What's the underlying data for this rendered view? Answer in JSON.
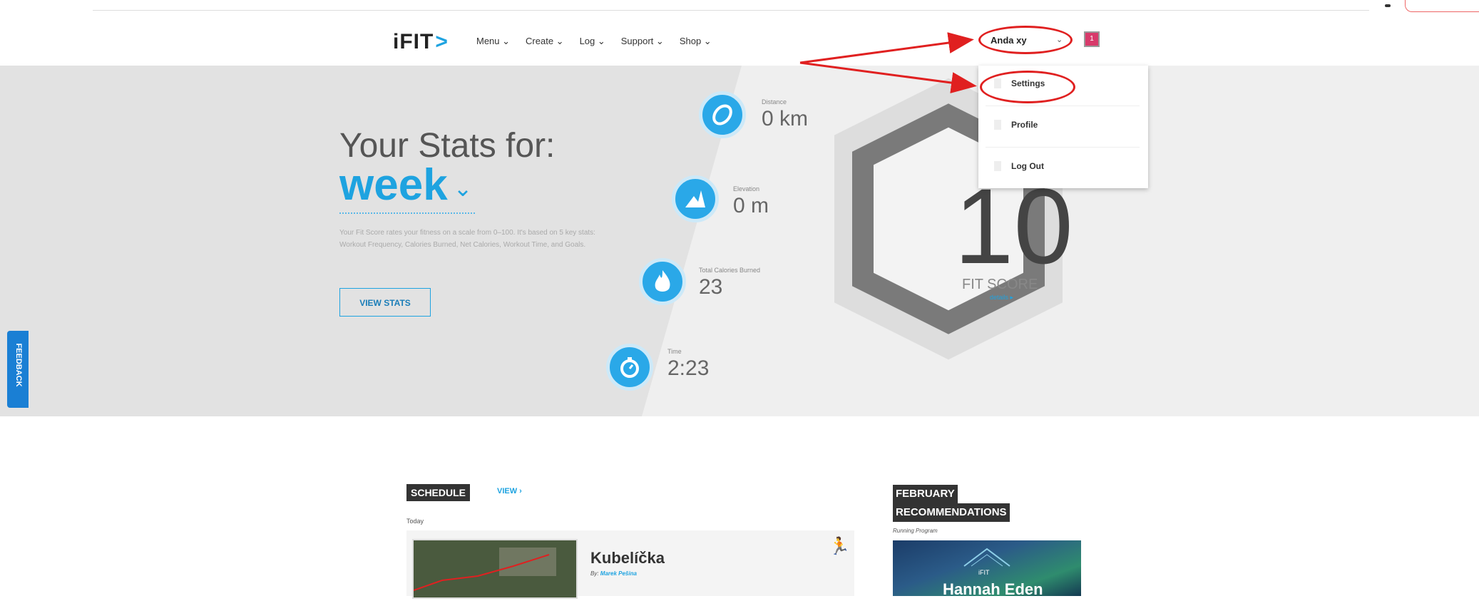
{
  "header": {
    "logo": "iFIT",
    "logo_chevron": ">",
    "nav": [
      "Menu ⌄",
      "Create ⌄",
      "Log ⌄",
      "Support ⌄",
      "Shop ⌄"
    ],
    "user_name": "Anda xy",
    "user_caret": "⌄",
    "notification_count": "1"
  },
  "dropdown": {
    "items": [
      "Settings",
      "Profile",
      "Log Out"
    ]
  },
  "hero": {
    "title": "Your Stats for:",
    "period": "week",
    "period_caret": "⌄",
    "description": "Your Fit Score rates your fitness on a scale from 0–100. It's based on 5 key stats: Workout Frequency, Calories Burned, Net Calories, Workout Time, and Goals.",
    "button": "VIEW STATS",
    "stats": [
      {
        "label": "Distance",
        "value": "0 km",
        "icon": "shoe-icon"
      },
      {
        "label": "Elevation",
        "value": "0 m",
        "icon": "mountain-icon"
      },
      {
        "label": "Total Calories Burned",
        "value": "23",
        "icon": "flame-icon"
      },
      {
        "label": "Time",
        "value": "2:23",
        "icon": "stopwatch-icon"
      }
    ],
    "fit_score": "10",
    "fit_score_label": "FIT SCORE",
    "fit_score_details": "details ▸"
  },
  "feedback": "FEEDBACK",
  "schedule": {
    "title": "SCHEDULE",
    "view": "VIEW ›",
    "today": "Today",
    "workout_title": "Kubelíčka",
    "by_prefix": "By:",
    "by_name": "Marek Pešina",
    "runner_icon": "🏃"
  },
  "recommendations": {
    "title_line1": "FEBRUARY",
    "title_line2": "RECOMMENDATIONS",
    "subtitle": "Running Program",
    "brand": "iFIT",
    "name": "Hannah Eden"
  },
  "colors": {
    "accent": "#1ea3e0",
    "annotation": "#e02020",
    "feedback": "#1a7fd4"
  }
}
